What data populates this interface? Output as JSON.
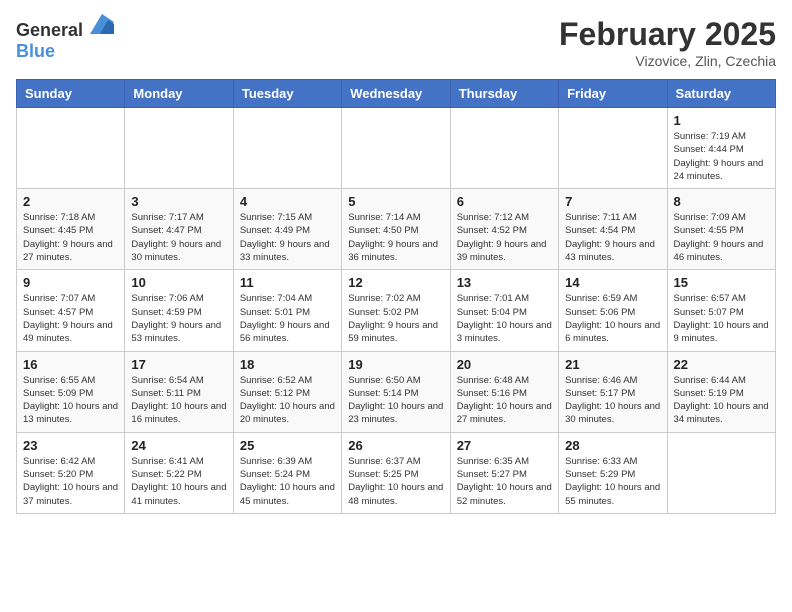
{
  "header": {
    "logo_general": "General",
    "logo_blue": "Blue",
    "month_title": "February 2025",
    "subtitle": "Vizovice, Zlin, Czechia"
  },
  "calendar": {
    "days_of_week": [
      "Sunday",
      "Monday",
      "Tuesday",
      "Wednesday",
      "Thursday",
      "Friday",
      "Saturday"
    ],
    "weeks": [
      [
        {
          "day": "",
          "info": ""
        },
        {
          "day": "",
          "info": ""
        },
        {
          "day": "",
          "info": ""
        },
        {
          "day": "",
          "info": ""
        },
        {
          "day": "",
          "info": ""
        },
        {
          "day": "",
          "info": ""
        },
        {
          "day": "1",
          "info": "Sunrise: 7:19 AM\nSunset: 4:44 PM\nDaylight: 9 hours and 24 minutes."
        }
      ],
      [
        {
          "day": "2",
          "info": "Sunrise: 7:18 AM\nSunset: 4:45 PM\nDaylight: 9 hours and 27 minutes."
        },
        {
          "day": "3",
          "info": "Sunrise: 7:17 AM\nSunset: 4:47 PM\nDaylight: 9 hours and 30 minutes."
        },
        {
          "day": "4",
          "info": "Sunrise: 7:15 AM\nSunset: 4:49 PM\nDaylight: 9 hours and 33 minutes."
        },
        {
          "day": "5",
          "info": "Sunrise: 7:14 AM\nSunset: 4:50 PM\nDaylight: 9 hours and 36 minutes."
        },
        {
          "day": "6",
          "info": "Sunrise: 7:12 AM\nSunset: 4:52 PM\nDaylight: 9 hours and 39 minutes."
        },
        {
          "day": "7",
          "info": "Sunrise: 7:11 AM\nSunset: 4:54 PM\nDaylight: 9 hours and 43 minutes."
        },
        {
          "day": "8",
          "info": "Sunrise: 7:09 AM\nSunset: 4:55 PM\nDaylight: 9 hours and 46 minutes."
        }
      ],
      [
        {
          "day": "9",
          "info": "Sunrise: 7:07 AM\nSunset: 4:57 PM\nDaylight: 9 hours and 49 minutes."
        },
        {
          "day": "10",
          "info": "Sunrise: 7:06 AM\nSunset: 4:59 PM\nDaylight: 9 hours and 53 minutes."
        },
        {
          "day": "11",
          "info": "Sunrise: 7:04 AM\nSunset: 5:01 PM\nDaylight: 9 hours and 56 minutes."
        },
        {
          "day": "12",
          "info": "Sunrise: 7:02 AM\nSunset: 5:02 PM\nDaylight: 9 hours and 59 minutes."
        },
        {
          "day": "13",
          "info": "Sunrise: 7:01 AM\nSunset: 5:04 PM\nDaylight: 10 hours and 3 minutes."
        },
        {
          "day": "14",
          "info": "Sunrise: 6:59 AM\nSunset: 5:06 PM\nDaylight: 10 hours and 6 minutes."
        },
        {
          "day": "15",
          "info": "Sunrise: 6:57 AM\nSunset: 5:07 PM\nDaylight: 10 hours and 9 minutes."
        }
      ],
      [
        {
          "day": "16",
          "info": "Sunrise: 6:55 AM\nSunset: 5:09 PM\nDaylight: 10 hours and 13 minutes."
        },
        {
          "day": "17",
          "info": "Sunrise: 6:54 AM\nSunset: 5:11 PM\nDaylight: 10 hours and 16 minutes."
        },
        {
          "day": "18",
          "info": "Sunrise: 6:52 AM\nSunset: 5:12 PM\nDaylight: 10 hours and 20 minutes."
        },
        {
          "day": "19",
          "info": "Sunrise: 6:50 AM\nSunset: 5:14 PM\nDaylight: 10 hours and 23 minutes."
        },
        {
          "day": "20",
          "info": "Sunrise: 6:48 AM\nSunset: 5:16 PM\nDaylight: 10 hours and 27 minutes."
        },
        {
          "day": "21",
          "info": "Sunrise: 6:46 AM\nSunset: 5:17 PM\nDaylight: 10 hours and 30 minutes."
        },
        {
          "day": "22",
          "info": "Sunrise: 6:44 AM\nSunset: 5:19 PM\nDaylight: 10 hours and 34 minutes."
        }
      ],
      [
        {
          "day": "23",
          "info": "Sunrise: 6:42 AM\nSunset: 5:20 PM\nDaylight: 10 hours and 37 minutes."
        },
        {
          "day": "24",
          "info": "Sunrise: 6:41 AM\nSunset: 5:22 PM\nDaylight: 10 hours and 41 minutes."
        },
        {
          "day": "25",
          "info": "Sunrise: 6:39 AM\nSunset: 5:24 PM\nDaylight: 10 hours and 45 minutes."
        },
        {
          "day": "26",
          "info": "Sunrise: 6:37 AM\nSunset: 5:25 PM\nDaylight: 10 hours and 48 minutes."
        },
        {
          "day": "27",
          "info": "Sunrise: 6:35 AM\nSunset: 5:27 PM\nDaylight: 10 hours and 52 minutes."
        },
        {
          "day": "28",
          "info": "Sunrise: 6:33 AM\nSunset: 5:29 PM\nDaylight: 10 hours and 55 minutes."
        },
        {
          "day": "",
          "info": ""
        }
      ]
    ]
  }
}
